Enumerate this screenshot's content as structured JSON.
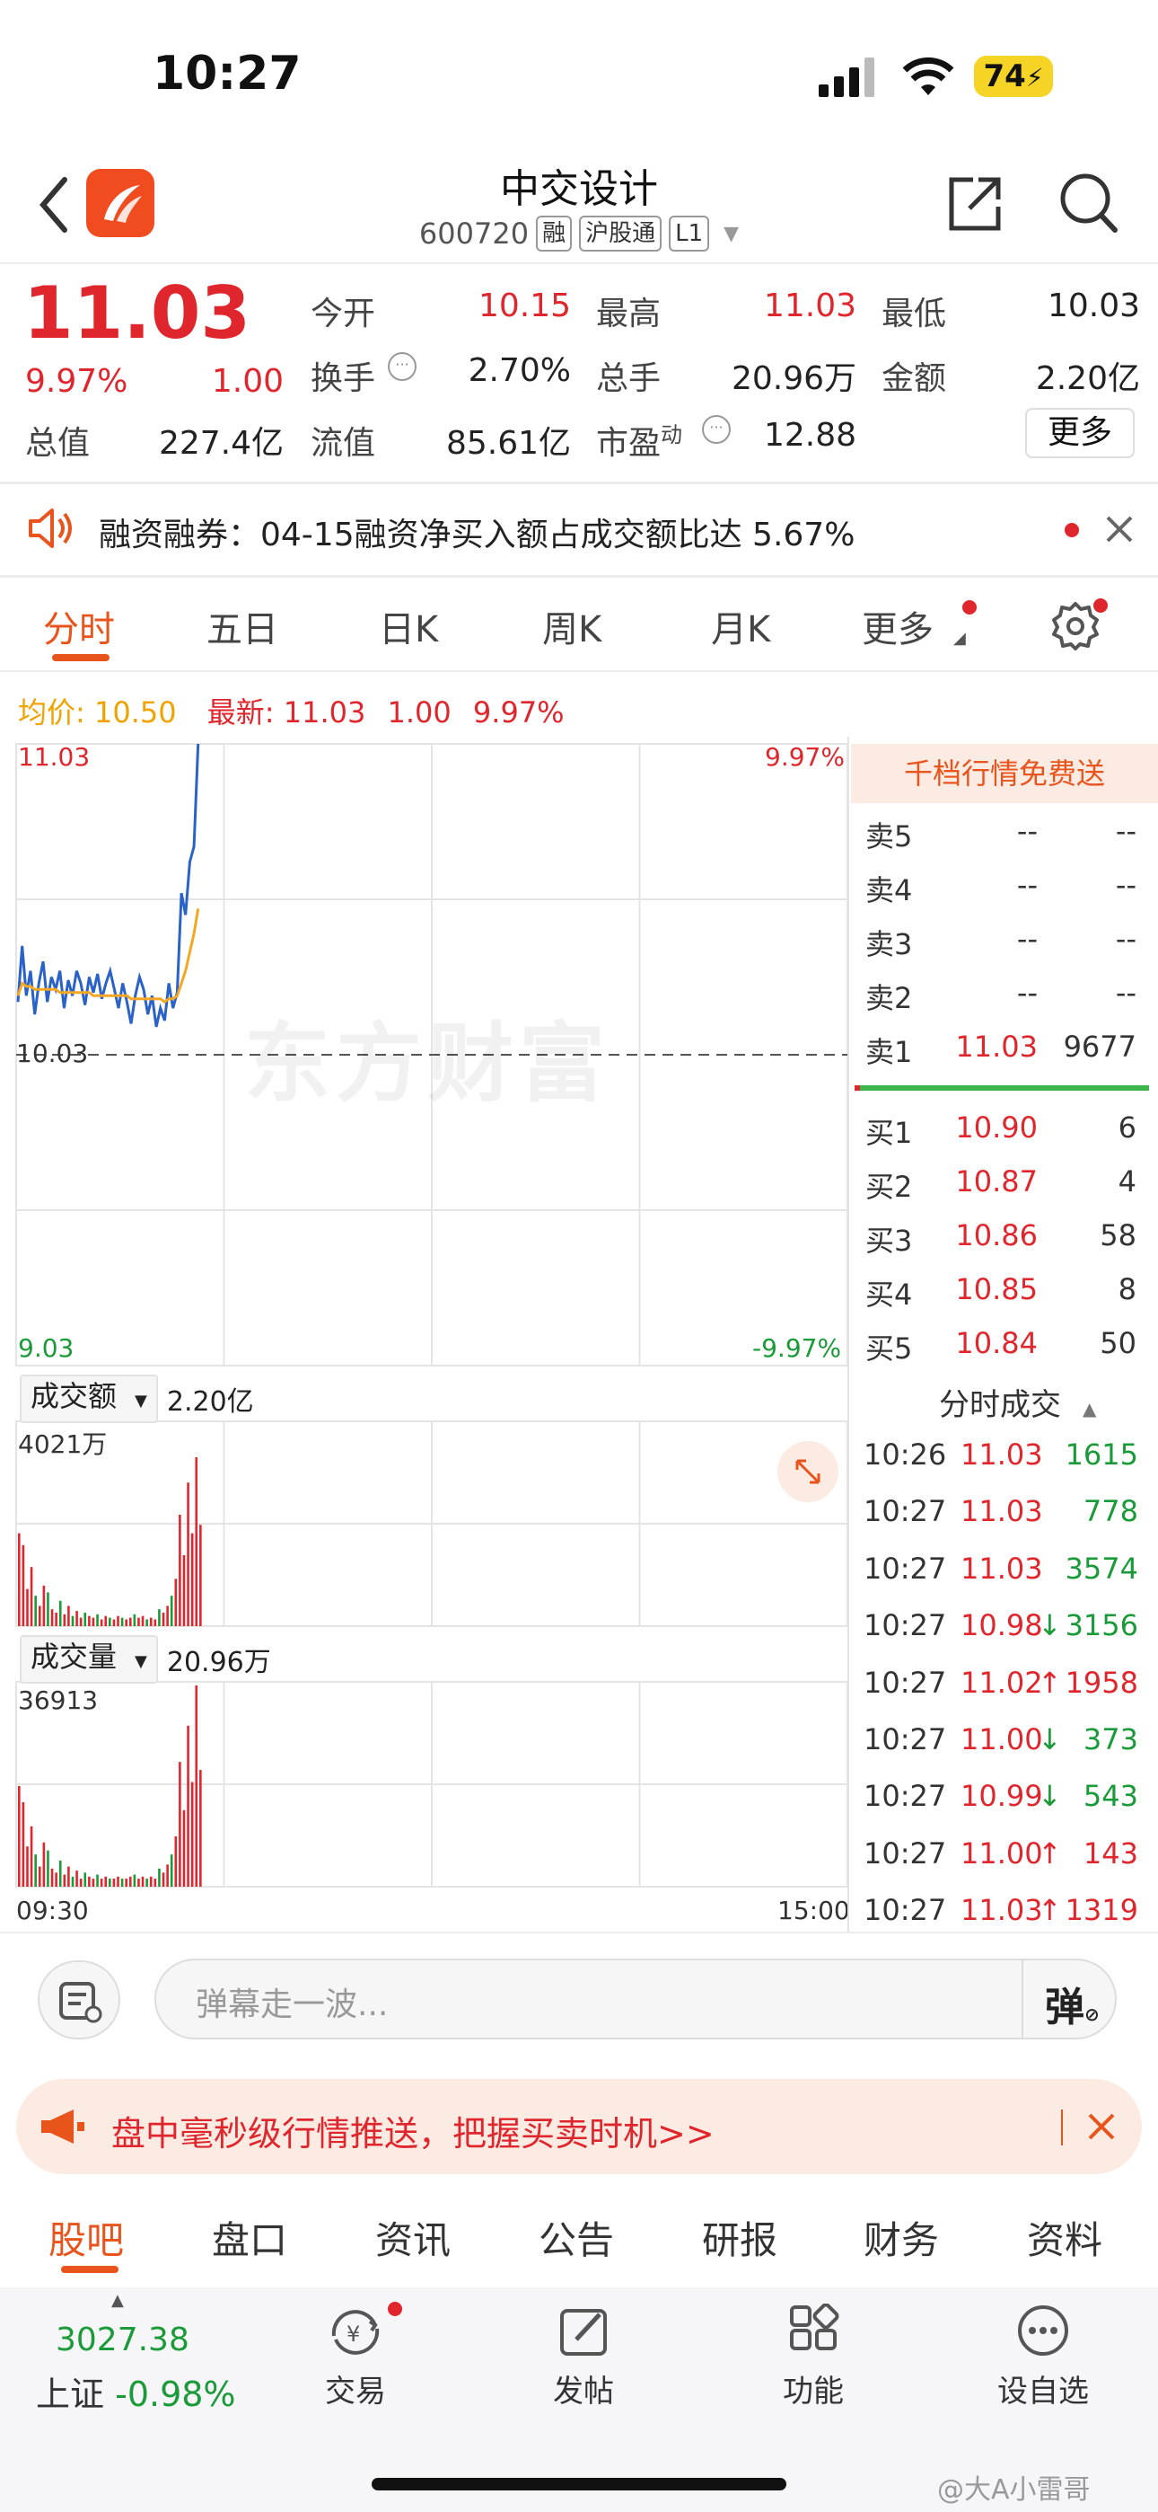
{
  "status": {
    "time": "10:27",
    "battery": "74"
  },
  "header": {
    "title": "中交设计",
    "code": "600720",
    "tags": [
      "融",
      "沪股通",
      "L1"
    ]
  },
  "quote": {
    "price": "11.03",
    "pct": "9.97%",
    "change": "1.00",
    "fields": [
      {
        "label": "今开",
        "value": "10.15"
      },
      {
        "label": "最高",
        "value": "11.03"
      },
      {
        "label": "最低",
        "value": "10.03"
      },
      {
        "label": "换手",
        "value": "2.70%"
      },
      {
        "label": "总手",
        "value": "20.96万"
      },
      {
        "label": "金额",
        "value": "2.20亿"
      },
      {
        "label": "总值",
        "value": "227.4亿"
      },
      {
        "label": "流值",
        "value": "85.61亿"
      },
      {
        "label": "市盈",
        "sup": "动",
        "value": "12.88"
      }
    ],
    "more": "更多"
  },
  "notice": {
    "text": "融资融券：04-15融资净买入额占成交额比达 5.67%"
  },
  "tabs": [
    "分时",
    "五日",
    "日K",
    "周K",
    "月K",
    "更多"
  ],
  "chart": {
    "avg_label": "均价:",
    "avg_value": "10.50",
    "latest_label": "最新:",
    "latest_value": "11.03",
    "latest_change": "1.00",
    "latest_pct": "9.97%",
    "top_left": "11.03",
    "top_right": "9.97%",
    "mid": "10.03",
    "bottom_left": "9.03",
    "bottom_right": "-9.97%",
    "watermark": "东方财富",
    "amount_btn": "成交额",
    "amount_value": "2.20亿",
    "amount_max": "4021万",
    "volume_btn": "成交量",
    "volume_value": "20.96万",
    "volume_max": "36913",
    "time_start": "09:30",
    "time_end": "15:00"
  },
  "orderbook": {
    "banner": "千档行情免费送",
    "sells": [
      {
        "label": "卖5",
        "price": "--",
        "vol": "--"
      },
      {
        "label": "卖4",
        "price": "--",
        "vol": "--"
      },
      {
        "label": "卖3",
        "price": "--",
        "vol": "--"
      },
      {
        "label": "卖2",
        "price": "--",
        "vol": "--"
      },
      {
        "label": "卖1",
        "price": "11.03",
        "vol": "9677"
      }
    ],
    "buys": [
      {
        "label": "买1",
        "price": "10.90",
        "vol": "6"
      },
      {
        "label": "买2",
        "price": "10.87",
        "vol": "4"
      },
      {
        "label": "买3",
        "price": "10.86",
        "vol": "58"
      },
      {
        "label": "买4",
        "price": "10.85",
        "vol": "8"
      },
      {
        "label": "买5",
        "price": "10.84",
        "vol": "50"
      }
    ],
    "trades_title": "分时成交",
    "trades": [
      {
        "time": "10:26",
        "price": "11.03",
        "dir": "",
        "vol": "1615",
        "vc": "green"
      },
      {
        "time": "10:27",
        "price": "11.03",
        "dir": "",
        "vol": "778",
        "vc": "green"
      },
      {
        "time": "10:27",
        "price": "11.03",
        "dir": "",
        "vol": "3574",
        "vc": "green"
      },
      {
        "time": "10:27",
        "price": "10.98",
        "dir": "↓",
        "vol": "3156",
        "vc": "green"
      },
      {
        "time": "10:27",
        "price": "11.02",
        "dir": "↑",
        "vol": "1958",
        "vc": "red"
      },
      {
        "time": "10:27",
        "price": "11.00",
        "dir": "↓",
        "vol": "373",
        "vc": "green"
      },
      {
        "time": "10:27",
        "price": "10.99",
        "dir": "↓",
        "vol": "543",
        "vc": "green"
      },
      {
        "time": "10:27",
        "price": "11.00",
        "dir": "↑",
        "vol": "143",
        "vc": "red"
      },
      {
        "time": "10:27",
        "price": "11.03",
        "dir": "↑",
        "vol": "1319",
        "vc": "red"
      }
    ]
  },
  "comment": {
    "placeholder": "弹幕走一波...",
    "danmu": "弹"
  },
  "promo": {
    "text": "盘中毫秒级行情推送，把握买卖时机>>"
  },
  "bottom_tabs": [
    "股吧",
    "盘口",
    "资讯",
    "公告",
    "研报",
    "财务",
    "资料"
  ],
  "nav": {
    "index_value": "3027.38",
    "index_name": "上证",
    "index_pct": "-0.98%",
    "items": [
      "交易",
      "发帖",
      "功能",
      "设自选"
    ]
  },
  "watermark_footer": "@大A小雷哥",
  "chart_data": {
    "type": "line",
    "ylim": [
      9.03,
      11.03
    ],
    "price": [
      10.2,
      10.38,
      10.22,
      10.3,
      10.16,
      10.26,
      10.33,
      10.2,
      10.28,
      10.24,
      10.3,
      10.18,
      10.27,
      10.22,
      10.3,
      10.26,
      10.19,
      10.28,
      10.23,
      10.29,
      10.21,
      10.26,
      10.3,
      10.24,
      10.18,
      10.26,
      10.2,
      10.13,
      10.22,
      10.28,
      10.24,
      10.16,
      10.22,
      10.12,
      10.18,
      10.14,
      10.26,
      10.18,
      10.23,
      10.55,
      10.48,
      10.65,
      10.7,
      11.03
    ],
    "avg": [
      10.22,
      10.26,
      10.25,
      10.25,
      10.24,
      10.24,
      10.24,
      10.24,
      10.24,
      10.24,
      10.23,
      10.23,
      10.23,
      10.23,
      10.23,
      10.23,
      10.23,
      10.23,
      10.22,
      10.22,
      10.22,
      10.22,
      10.22,
      10.22,
      10.22,
      10.22,
      10.22,
      10.21,
      10.21,
      10.21,
      10.21,
      10.21,
      10.21,
      10.21,
      10.21,
      10.2,
      10.21,
      10.21,
      10.22,
      10.26,
      10.3,
      10.36,
      10.42,
      10.5
    ],
    "amount": [
      0.55,
      0.48,
      0.22,
      0.35,
      0.18,
      0.12,
      0.24,
      0.2,
      0.1,
      0.08,
      0.15,
      0.07,
      0.12,
      0.06,
      0.09,
      0.05,
      0.08,
      0.06,
      0.05,
      0.07,
      0.04,
      0.06,
      0.05,
      0.04,
      0.06,
      0.05,
      0.04,
      0.05,
      0.07,
      0.05,
      0.06,
      0.04,
      0.05,
      0.04,
      0.1,
      0.08,
      0.12,
      0.18,
      0.28,
      0.66,
      0.42,
      0.85,
      0.55,
      1.0,
      0.6
    ],
    "volume": [
      0.5,
      0.42,
      0.2,
      0.3,
      0.16,
      0.1,
      0.22,
      0.18,
      0.09,
      0.07,
      0.13,
      0.06,
      0.1,
      0.05,
      0.08,
      0.04,
      0.07,
      0.05,
      0.04,
      0.06,
      0.04,
      0.05,
      0.04,
      0.04,
      0.05,
      0.04,
      0.04,
      0.05,
      0.06,
      0.04,
      0.05,
      0.04,
      0.05,
      0.04,
      0.09,
      0.07,
      0.11,
      0.16,
      0.25,
      0.62,
      0.38,
      0.8,
      0.52,
      1.0,
      0.58
    ],
    "colors": {
      "price": "#2a62c9",
      "avg": "#f5a623",
      "up": "#e0262d",
      "down": "#1a9a38"
    }
  }
}
